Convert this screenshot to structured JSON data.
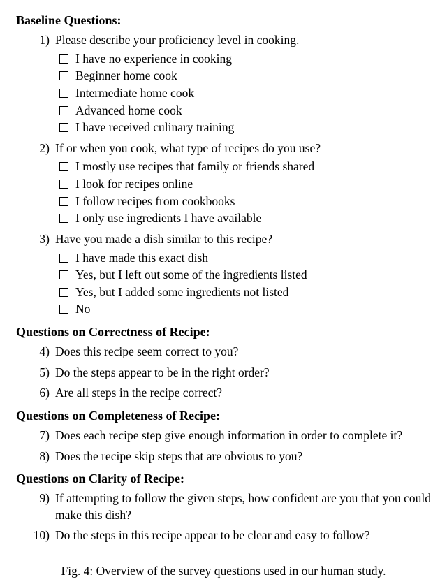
{
  "sections": [
    {
      "title": "Baseline Questions:",
      "questions": [
        {
          "num": "1)",
          "text": "Please describe your proficiency level in cooking.",
          "options": [
            "I have no experience in cooking",
            "Beginner home cook",
            "Intermediate home cook",
            "Advanced home cook",
            "I have received culinary training"
          ]
        },
        {
          "num": "2)",
          "text": "If or when you cook, what type of recipes do you use?",
          "options": [
            "I mostly use recipes that family or friends shared",
            "I look for recipes online",
            "I follow recipes from cookbooks",
            "I only use ingredients I have available"
          ]
        },
        {
          "num": "3)",
          "text": "Have you made a dish similar to this recipe?",
          "options": [
            "I have made this exact dish",
            "Yes, but I left out some of the ingredients listed",
            "Yes, but I added some ingredients not listed",
            "No"
          ]
        }
      ]
    },
    {
      "title": "Questions on Correctness of Recipe:",
      "questions": [
        {
          "num": "4)",
          "text": "Does this recipe seem correct to you?",
          "options": []
        },
        {
          "num": "5)",
          "text": "Do the steps appear to be in the right order?",
          "options": []
        },
        {
          "num": "6)",
          "text": "Are all steps in the recipe correct?",
          "options": []
        }
      ]
    },
    {
      "title": "Questions on Completeness of Recipe:",
      "questions": [
        {
          "num": "7)",
          "text": "Does each recipe step give enough information in order to complete it?",
          "options": []
        },
        {
          "num": "8)",
          "text": "Does the recipe skip steps that are obvious to you?",
          "options": []
        }
      ]
    },
    {
      "title": "Questions on Clarity of Recipe:",
      "questions": [
        {
          "num": "9)",
          "text": "If attempting to follow the given steps, how confident are you that you could make this dish?",
          "options": []
        },
        {
          "num": "10)",
          "text": "Do the steps in this recipe appear to be clear and easy to follow?",
          "options": []
        }
      ]
    }
  ],
  "caption": "Fig. 4: Overview of the survey questions used in our human study."
}
